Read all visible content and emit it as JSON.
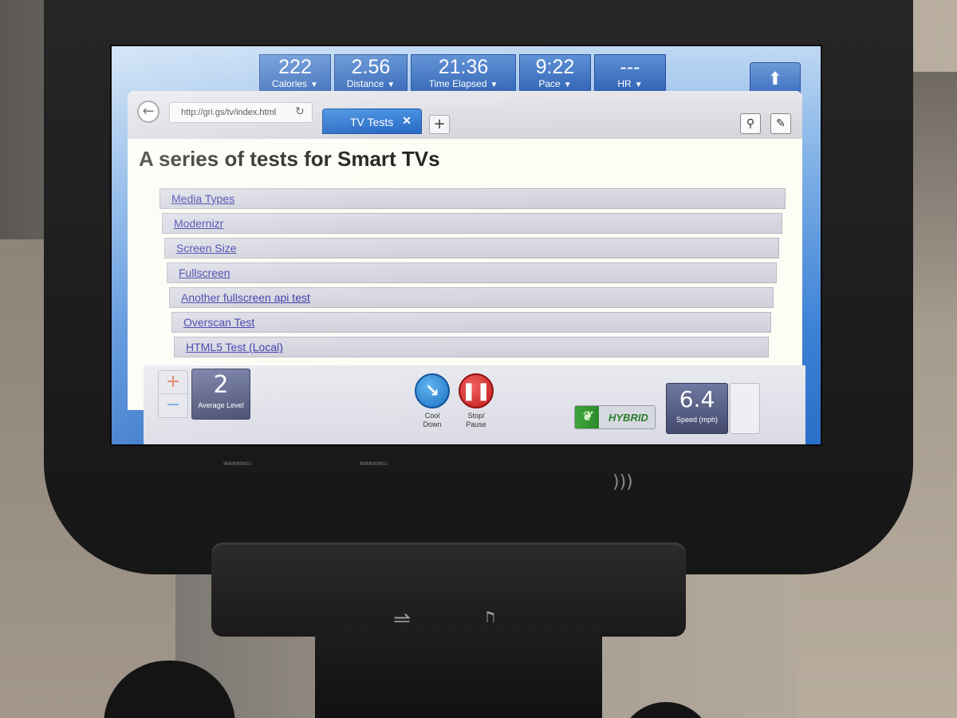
{
  "stats": [
    {
      "value": "222",
      "label": "Calories",
      "caret": "▼"
    },
    {
      "value": "2.56",
      "label": "Distance",
      "caret": "▼"
    },
    {
      "value": "21:36",
      "label": "Time Elapsed",
      "caret": "▼"
    },
    {
      "value": "9:22",
      "label": "Pace",
      "caret": "▼"
    },
    {
      "value": "---",
      "label": "HR",
      "caret": "▼"
    }
  ],
  "browser": {
    "url": "http://gri.gs/tv/index.html",
    "tab_label": "TV Tests",
    "tab_close": "✕",
    "new_tab": "+"
  },
  "page": {
    "title": "A series of tests for Smart TVs",
    "links": [
      "Media Types",
      "Modernizr",
      "Screen Size",
      "Fullscreen",
      "Another fullscreen api test",
      "Overscan Test",
      "HTML5 Test (Local)"
    ]
  },
  "controls": {
    "level_value": "2",
    "level_label": "Average Level",
    "plus": "+",
    "minus": "−",
    "cool_down_label_1": "Cool",
    "cool_down_label_2": "Down",
    "stop_label_1": "Stop/",
    "stop_label_2": "Pause",
    "hybrid_label": "HYBRID",
    "speed_value": "6.4",
    "speed_label": "Speed (mph)"
  },
  "hardware": {
    "warning_1": "WARNING!",
    "warning_2": "WARNING!"
  },
  "colors": {
    "stat_blue": "#2f62b4",
    "tab_blue": "#1f63c2",
    "link_color": "#3732a8",
    "stop_red": "#c41a1a",
    "cool_blue": "#1a6fc4",
    "hybrid_green": "#3da53a"
  }
}
